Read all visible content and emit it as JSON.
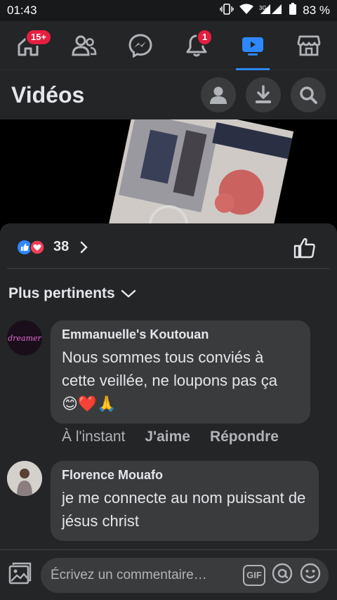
{
  "status_bar": {
    "time": "01:43",
    "battery": "83 %",
    "network": "3G"
  },
  "nav": {
    "home_badge": "15+",
    "notifications_badge": "1",
    "items": [
      "home-icon",
      "friends-icon",
      "messenger-icon",
      "bell-icon",
      "video-icon",
      "marketplace-icon"
    ]
  },
  "header": {
    "title": "Vidéos"
  },
  "post": {
    "reaction_count": "38"
  },
  "comments": {
    "sort_label": "Plus pertinents",
    "items": [
      {
        "author": "Emmanuelle's Koutouan",
        "text": "Nous sommes tous conviés à cette veillée, ne loupons pas ça",
        "emojis": "😊❤️🙏",
        "avatar_text": "dreamer",
        "time": "À l'instant",
        "like_label": "J'aime",
        "reply_label": "Répondre"
      },
      {
        "author": "Florence Mouafo",
        "text": "je me connecte au nom puissant de jésus christ"
      }
    ]
  },
  "composer": {
    "placeholder": "Écrivez un commentaire…",
    "gif_label": "GIF"
  },
  "colors": {
    "accent": "#2d88ff",
    "badge": "#e41e3f",
    "background": "#18191a",
    "surface": "#242526",
    "bubble": "#3a3b3c"
  }
}
